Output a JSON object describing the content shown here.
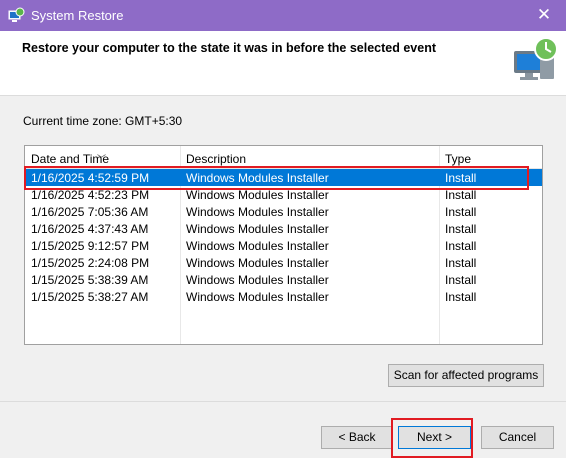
{
  "window": {
    "title": "System Restore",
    "close_glyph": "✕",
    "app_icon": "system-restore-icon"
  },
  "header": {
    "heading": "Restore your computer to the state it was in before the selected event",
    "icon": "system-restore-clock-icon"
  },
  "timezone": "Current time zone: GMT+5:30",
  "list": {
    "columns": [
      "Date and Time",
      "Description",
      "Type"
    ],
    "sorted_column": "Date and Time",
    "selected_index": 0,
    "rows": [
      {
        "date": "1/16/2025 4:52:59 PM",
        "description": "Windows Modules Installer",
        "type": "Install"
      },
      {
        "date": "1/16/2025 4:52:23 PM",
        "description": "Windows Modules Installer",
        "type": "Install"
      },
      {
        "date": "1/16/2025 7:05:36 AM",
        "description": "Windows Modules Installer",
        "type": "Install"
      },
      {
        "date": "1/16/2025 4:37:43 AM",
        "description": "Windows Modules Installer",
        "type": "Install"
      },
      {
        "date": "1/15/2025 9:12:57 PM",
        "description": "Windows Modules Installer",
        "type": "Install"
      },
      {
        "date": "1/15/2025 2:24:08 PM",
        "description": "Windows Modules Installer",
        "type": "Install"
      },
      {
        "date": "1/15/2025 5:38:39 AM",
        "description": "Windows Modules Installer",
        "type": "Install"
      },
      {
        "date": "1/15/2025 5:38:27 AM",
        "description": "Windows Modules Installer",
        "type": "Install"
      }
    ]
  },
  "buttons": {
    "scan": "Scan for affected programs",
    "back": "< Back",
    "next": "Next >",
    "cancel": "Cancel"
  },
  "colors": {
    "titlebar": "#8e6bc7",
    "selection": "#0078d7",
    "highlight_frame": "#e11b22"
  }
}
